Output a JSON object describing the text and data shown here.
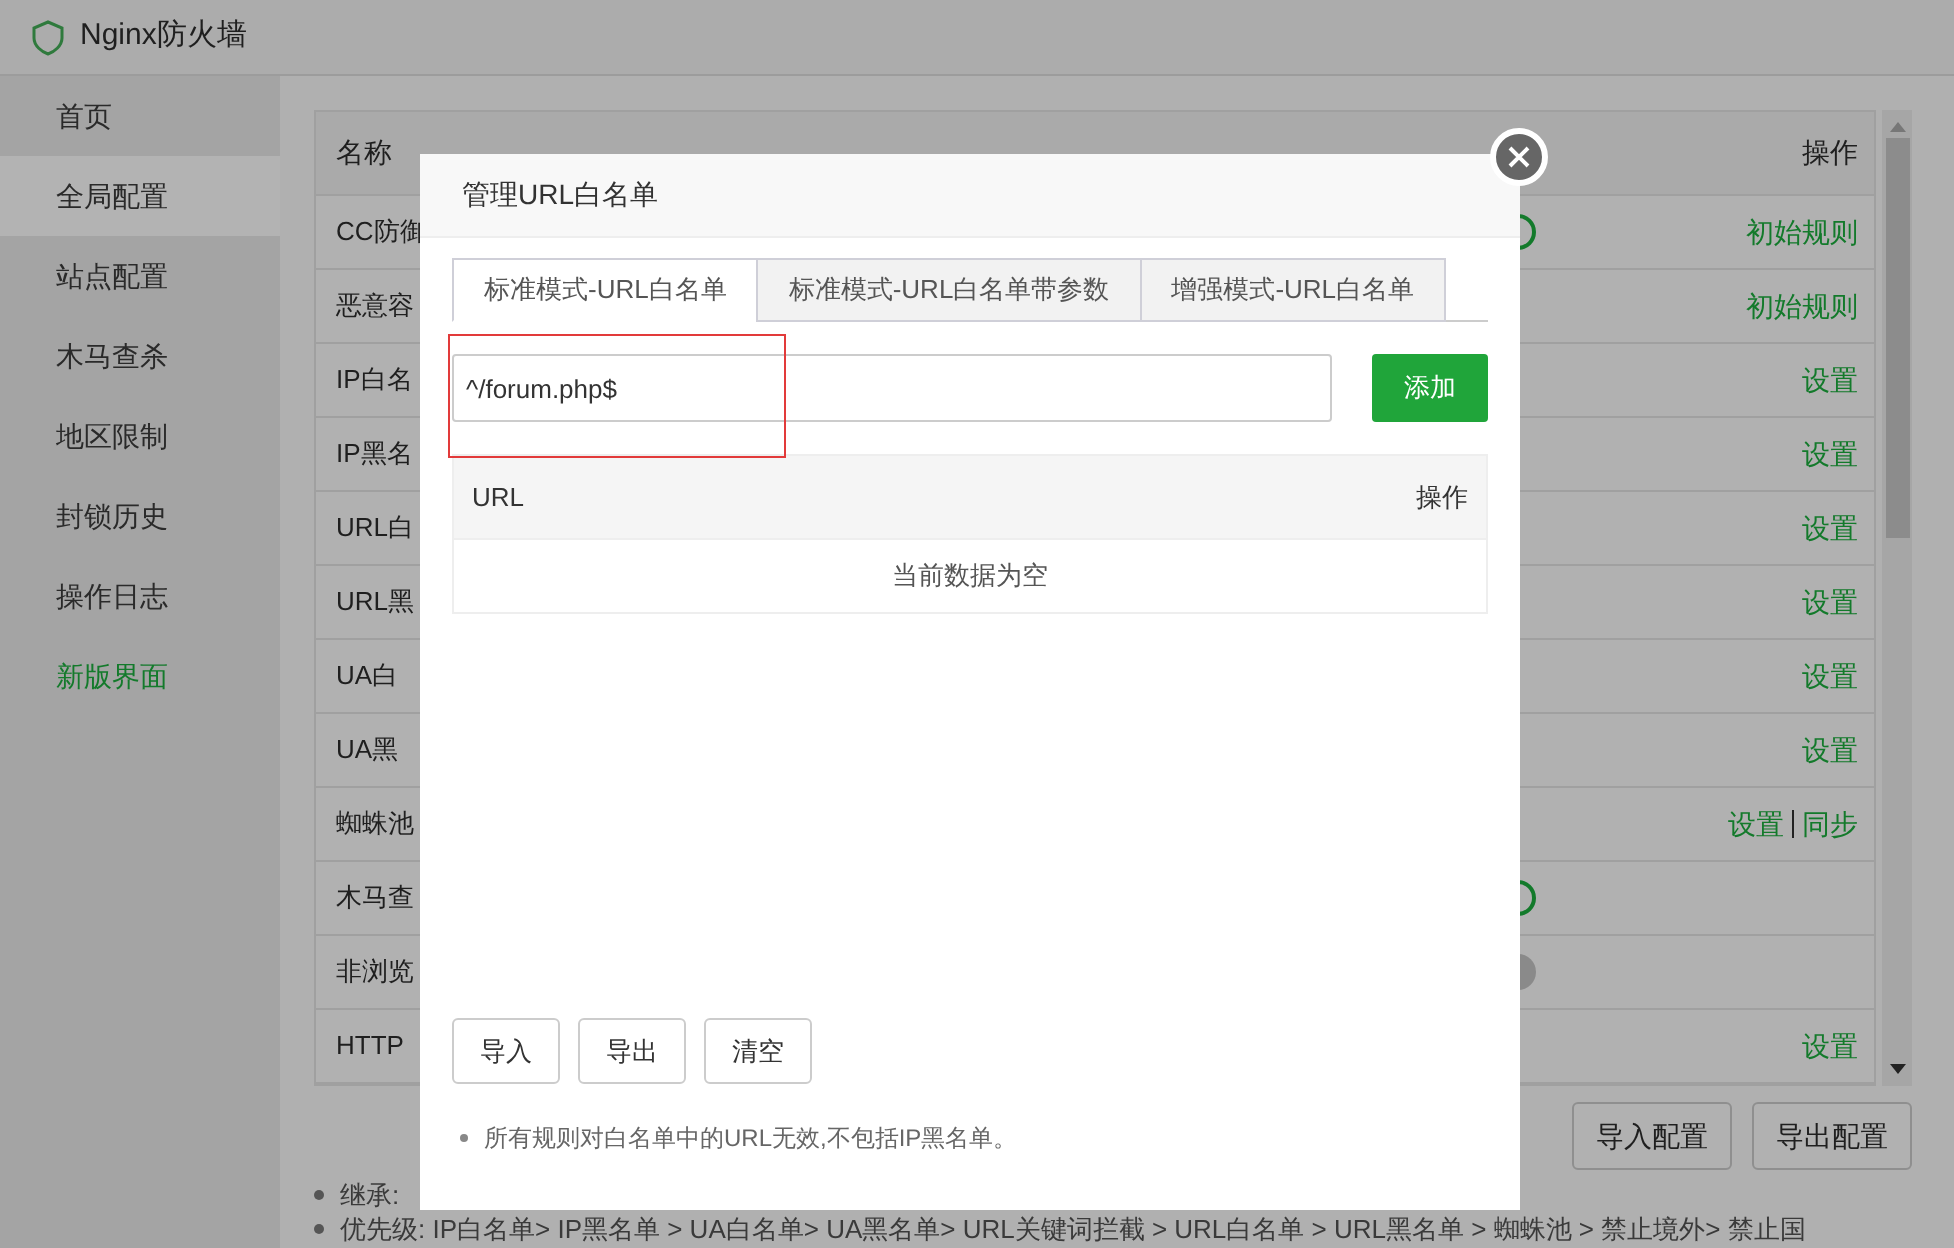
{
  "window": {
    "title": "Nginx防火墙"
  },
  "sidebar": {
    "items": [
      {
        "label": "首页",
        "kind": "nav",
        "selected": false
      },
      {
        "label": "全局配置",
        "kind": "nav",
        "selected": true
      },
      {
        "label": "站点配置",
        "kind": "nav",
        "selected": false
      },
      {
        "label": "木马查杀",
        "kind": "nav",
        "selected": false
      },
      {
        "label": "地区限制",
        "kind": "nav",
        "selected": false
      },
      {
        "label": "封锁历史",
        "kind": "nav",
        "selected": false
      },
      {
        "label": "操作日志",
        "kind": "nav",
        "selected": false
      },
      {
        "label": "新版界面",
        "kind": "link",
        "selected": false
      }
    ]
  },
  "table": {
    "columns": [
      "名称",
      "操作"
    ],
    "rows": [
      {
        "name": "CC防御",
        "switch_on": true,
        "actions": [
          "初始规则"
        ]
      },
      {
        "name": "恶意容",
        "actions": [
          "初始规则"
        ]
      },
      {
        "name": "IP白名",
        "actions": [
          "设置"
        ]
      },
      {
        "name": "IP黑名",
        "actions": [
          "设置"
        ]
      },
      {
        "name": "URL白",
        "actions": [
          "设置"
        ]
      },
      {
        "name": "URL黑",
        "actions": [
          "设置"
        ]
      },
      {
        "name": "UA白",
        "actions": [
          "设置"
        ]
      },
      {
        "name": "UA黑",
        "actions": [
          "设置"
        ]
      },
      {
        "name": "蜘蛛池",
        "actions": [
          "设置",
          "同步"
        ]
      },
      {
        "name": "木马查",
        "switch_on": true
      },
      {
        "name": "非浏览",
        "switch_on": false
      },
      {
        "name": "HTTP",
        "actions": [
          "设置"
        ]
      }
    ]
  },
  "page_buttons": [
    "导入配置",
    "导出配置"
  ],
  "notes": [
    "继承:",
    "优先级: IP白名单> IP黑名单 > UA白名单> UA黑名单> URL关键词拦截 > URL白名单 > URL黑名单 > 蜘蛛池 > 禁止境外> 禁止国"
  ],
  "dialog": {
    "title": "管理URL白名单",
    "tabs": [
      {
        "label": "标准模式-URL白名单",
        "selected": true
      },
      {
        "label": "标准模式-URL白名单带参数",
        "selected": false
      },
      {
        "label": "增强模式-URL白名单",
        "selected": false
      }
    ],
    "input": {
      "value": "^/forum.php$",
      "highlighted": true
    },
    "add_button": "添加",
    "list": {
      "columns": [
        "URL",
        "操作"
      ],
      "empty_text": "当前数据为空"
    },
    "buttons": [
      "导入",
      "导出",
      "清空"
    ],
    "note": "所有规则对白名单中的URL无效,不包括IP黑名单。"
  }
}
